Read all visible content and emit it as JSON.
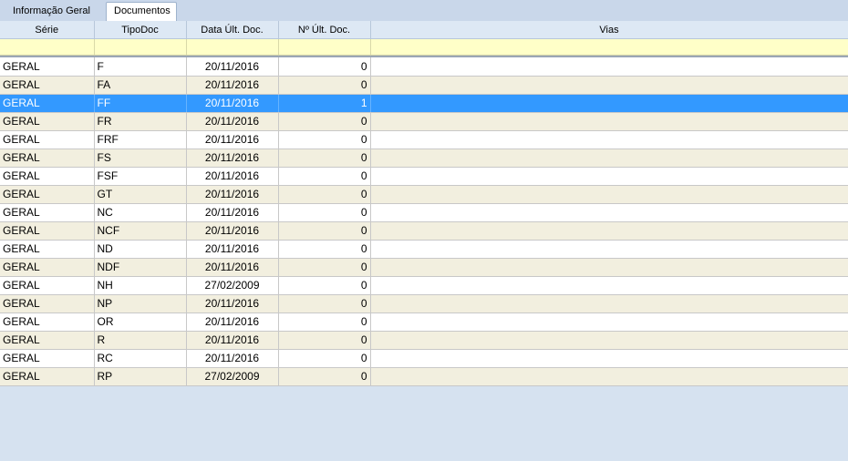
{
  "tabs": [
    {
      "label": "Informação Geral"
    },
    {
      "label": "Documentos"
    }
  ],
  "columns": [
    "Série",
    "TipoDoc",
    "Data Últ. Doc.",
    "Nº Últ. Doc.",
    "Vias"
  ],
  "rows": [
    {
      "serie": "GERAL",
      "tipo": "F",
      "data": "20/11/2016",
      "num": "0",
      "vias": ""
    },
    {
      "serie": "GERAL",
      "tipo": "FA",
      "data": "20/11/2016",
      "num": "0",
      "vias": ""
    },
    {
      "serie": "GERAL",
      "tipo": "FF",
      "data": "20/11/2016",
      "num": "1",
      "vias": ""
    },
    {
      "serie": "GERAL",
      "tipo": "FR",
      "data": "20/11/2016",
      "num": "0",
      "vias": ""
    },
    {
      "serie": "GERAL",
      "tipo": "FRF",
      "data": "20/11/2016",
      "num": "0",
      "vias": ""
    },
    {
      "serie": "GERAL",
      "tipo": "FS",
      "data": "20/11/2016",
      "num": "0",
      "vias": ""
    },
    {
      "serie": "GERAL",
      "tipo": "FSF",
      "data": "20/11/2016",
      "num": "0",
      "vias": ""
    },
    {
      "serie": "GERAL",
      "tipo": "GT",
      "data": "20/11/2016",
      "num": "0",
      "vias": ""
    },
    {
      "serie": "GERAL",
      "tipo": "NC",
      "data": "20/11/2016",
      "num": "0",
      "vias": ""
    },
    {
      "serie": "GERAL",
      "tipo": "NCF",
      "data": "20/11/2016",
      "num": "0",
      "vias": ""
    },
    {
      "serie": "GERAL",
      "tipo": "ND",
      "data": "20/11/2016",
      "num": "0",
      "vias": ""
    },
    {
      "serie": "GERAL",
      "tipo": "NDF",
      "data": "20/11/2016",
      "num": "0",
      "vias": ""
    },
    {
      "serie": "GERAL",
      "tipo": "NH",
      "data": "27/02/2009",
      "num": "0",
      "vias": ""
    },
    {
      "serie": "GERAL",
      "tipo": "NP",
      "data": "20/11/2016",
      "num": "0",
      "vias": ""
    },
    {
      "serie": "GERAL",
      "tipo": "OR",
      "data": "20/11/2016",
      "num": "0",
      "vias": ""
    },
    {
      "serie": "GERAL",
      "tipo": "R",
      "data": "20/11/2016",
      "num": "0",
      "vias": ""
    },
    {
      "serie": "GERAL",
      "tipo": "RC",
      "data": "20/11/2016",
      "num": "0",
      "vias": ""
    },
    {
      "serie": "GERAL",
      "tipo": "RP",
      "data": "27/02/2009",
      "num": "0",
      "vias": ""
    }
  ],
  "selected_row": 2,
  "colors": {
    "selection": "#3399ff",
    "alt_row": "#f2efdf",
    "filter_row": "#ffffc8",
    "background": "#d6e2f0"
  }
}
